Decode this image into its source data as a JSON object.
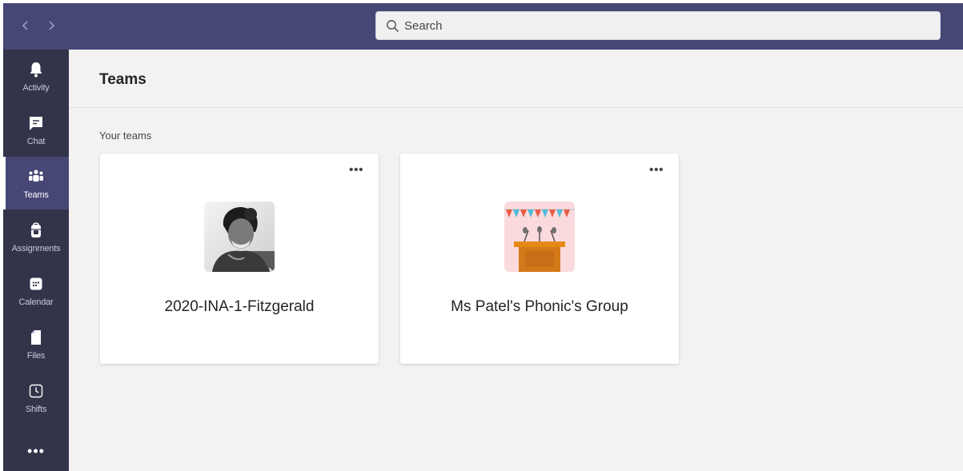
{
  "topbar": {
    "back_icon": "chevron-left-icon",
    "forward_icon": "chevron-right-icon",
    "search_placeholder": "Search",
    "search_icon": "search-icon",
    "bar_color": "#464775"
  },
  "rail": {
    "items": [
      {
        "label": "Activity",
        "icon": "bell-icon"
      },
      {
        "label": "Chat",
        "icon": "chat-icon"
      },
      {
        "label": "Teams",
        "icon": "teams-icon",
        "active": true
      },
      {
        "label": "Assignments",
        "icon": "backpack-icon"
      },
      {
        "label": "Calendar",
        "icon": "calendar-icon"
      },
      {
        "label": "Files",
        "icon": "file-icon"
      },
      {
        "label": "Shifts",
        "icon": "clock-icon"
      }
    ],
    "more": "•••",
    "rail_color": "#33344a"
  },
  "main": {
    "title": "Teams",
    "section_label": "Your teams",
    "teams": [
      {
        "name": "2020-INA-1-Fitzgerald",
        "avatar": "portrait-photo",
        "more": "•••"
      },
      {
        "name": "Ms Patel's Phonic's Group",
        "avatar": "podium-illustration",
        "more": "•••"
      }
    ]
  }
}
